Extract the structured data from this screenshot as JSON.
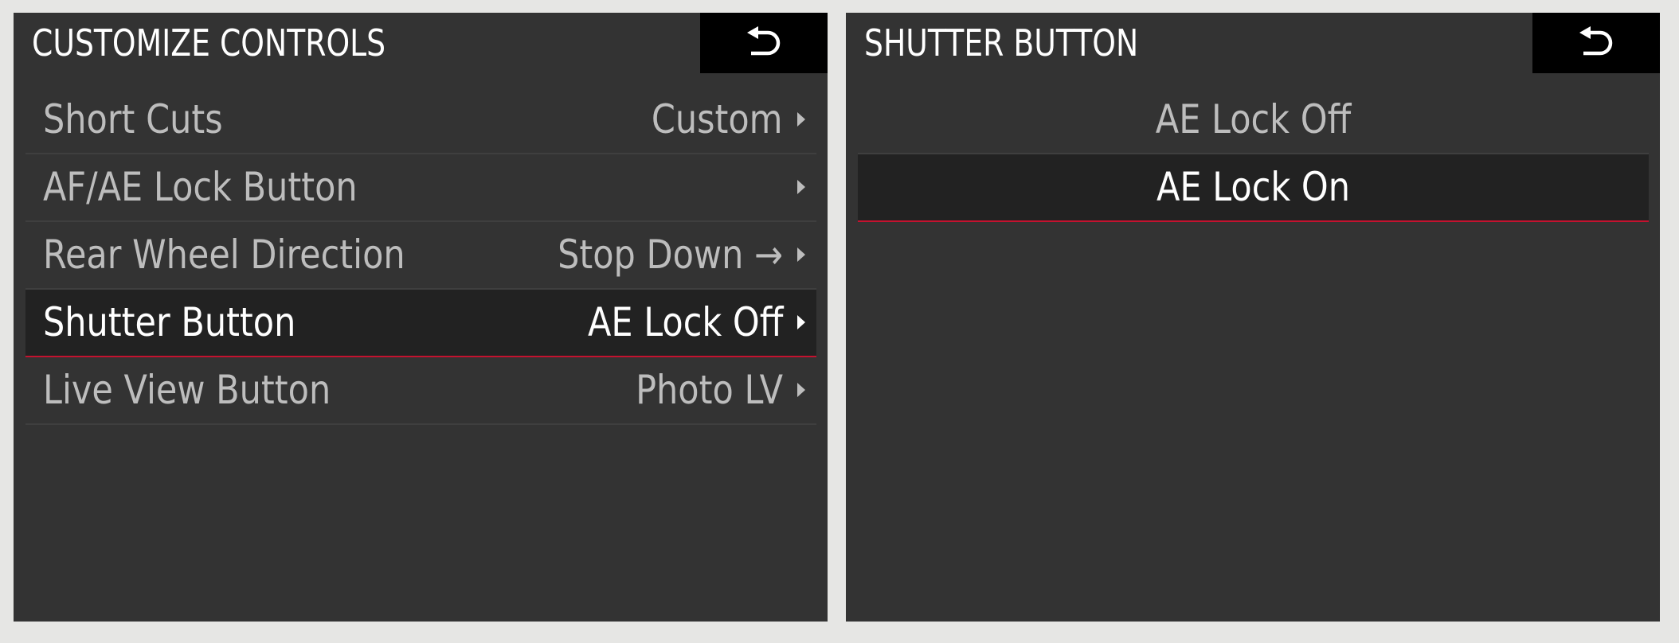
{
  "left_screen": {
    "title": "CUSTOMIZE CONTROLS",
    "back_icon": "back-arrow-icon",
    "items": [
      {
        "label": "Short Cuts",
        "value": "Custom",
        "selected": false
      },
      {
        "label": "AF/AE Lock Button",
        "value": "",
        "selected": false
      },
      {
        "label": "Rear Wheel Direction",
        "value": "Stop Down →",
        "selected": false
      },
      {
        "label": "Shutter Button",
        "value": "AE Lock Off",
        "selected": true
      },
      {
        "label": "Live View Button",
        "value": "Photo LV",
        "selected": false
      }
    ]
  },
  "right_screen": {
    "title": "SHUTTER BUTTON",
    "back_icon": "back-arrow-icon",
    "options": [
      {
        "label": "AE Lock Off",
        "selected": false
      },
      {
        "label": "AE Lock On",
        "selected": true
      }
    ]
  },
  "colors": {
    "page_background": "#e6e6e4",
    "screen_background": "#333333",
    "selected_row": "#222222",
    "accent_red": "#c4122f",
    "text_inactive": "#bdbdbd",
    "text_active": "#ffffff"
  }
}
